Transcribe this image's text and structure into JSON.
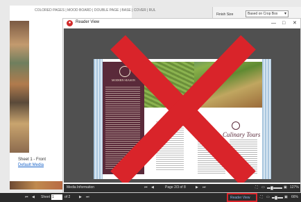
{
  "background": {
    "doc_header": "COLORED PAGES | MOOD BOARD | DOUBLE PAGE | BASE | COVER | RUL",
    "sheet_label": "Sheet 1 - Front",
    "default_media": "Default Media",
    "finish_size_label": "Finish Size",
    "finish_size_value": "Based on Crop Box"
  },
  "reader_window": {
    "title": "Reader View",
    "minimize": "—",
    "maximize": "□",
    "close": "✕",
    "content": {
      "magazine_name": "MODERN SEASON",
      "page_title": "Culinary Tours"
    },
    "footer": {
      "media_information": "Media Information",
      "page_indicator": "Page 2/3 of 8",
      "zoom": "127%"
    }
  },
  "bottom_bar": {
    "sheet_label": "Sheet",
    "sheet_value": "1",
    "of_total": "of 2",
    "reader_view_button": "Reader View",
    "zoom": "66%"
  },
  "colors": {
    "overlay_x": "#d9242a",
    "magazine_maroon": "#5a2a3a",
    "highlight_border": "#d9242a"
  },
  "icons": [
    "first-page-icon",
    "prev-page-icon",
    "next-page-icon",
    "last-page-icon",
    "fit-icon",
    "zoom-out-icon",
    "zoom-in-icon",
    "reader-view-icon"
  ]
}
